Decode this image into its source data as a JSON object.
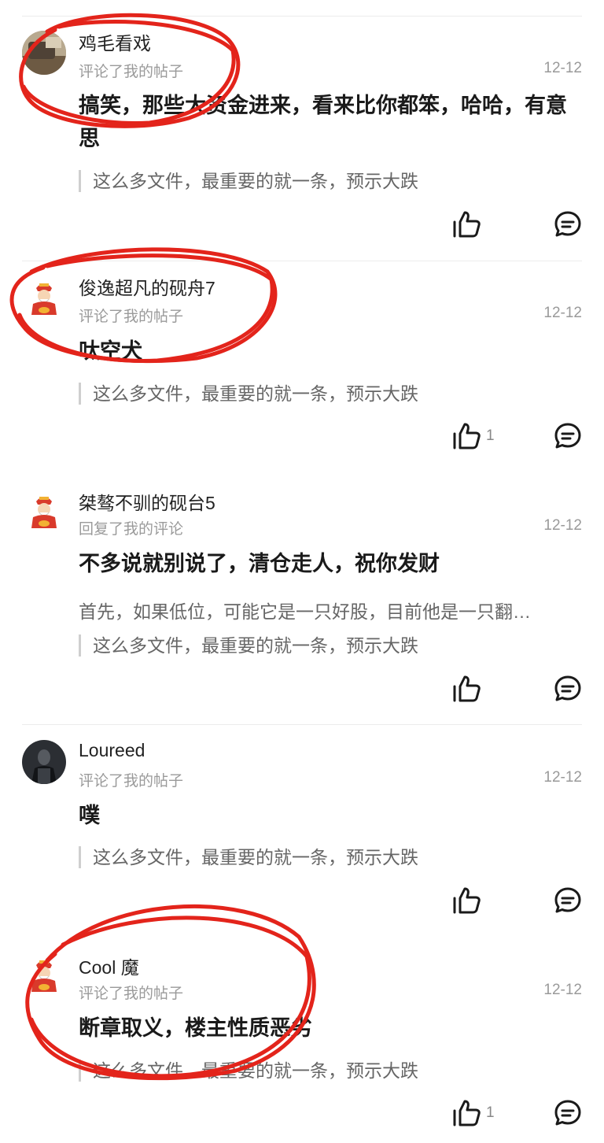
{
  "posts": [
    {
      "name": "鸡毛看戏",
      "action": "评论了我的帖子",
      "date": "12-12",
      "content": "搞笑，那些大资金进来，看来比你都笨，哈哈，有意思",
      "quote": "这么多文件，最重要的就一条，预示大跌",
      "likes": "",
      "avatar": "photo"
    },
    {
      "name": "俊逸超凡的砚舟7",
      "action": "评论了我的帖子",
      "date": "12-12",
      "content": "呔空犬",
      "quote": "这么多文件，最重要的就一条，预示大跌",
      "likes": "1",
      "avatar": "fortune-god"
    },
    {
      "name": "桀骜不驯的砚台5",
      "action": "回复了我的评论",
      "date": "12-12",
      "content": "不多说就别说了，清仓走人，祝你发财",
      "reply": "首先，如果低位，可能它是一只好股，目前他是一只翻…",
      "quote": "这么多文件，最重要的就一条，预示大跌",
      "likes": "",
      "avatar": "fortune-god"
    },
    {
      "name": "Loureed",
      "action": "评论了我的帖子",
      "date": "12-12",
      "content": "噗",
      "quote": "这么多文件，最重要的就一条，预示大跌",
      "likes": "",
      "avatar": "dark-photo"
    },
    {
      "name": "Cool 魔",
      "action": "评论了我的帖子",
      "date": "12-12",
      "content": "断章取义，楼主性质恶劣",
      "quote": "这么多文件，最重要的就一条，预示大跌",
      "likes": "1",
      "avatar": "fortune-god"
    }
  ],
  "colors": {
    "annotation_red": "#e3241b",
    "secondary_text": "#9a9a9a",
    "quote_bar": "#cfcfcf"
  },
  "icons": [
    "thumbs-up-icon",
    "comment-bubble-icon"
  ]
}
